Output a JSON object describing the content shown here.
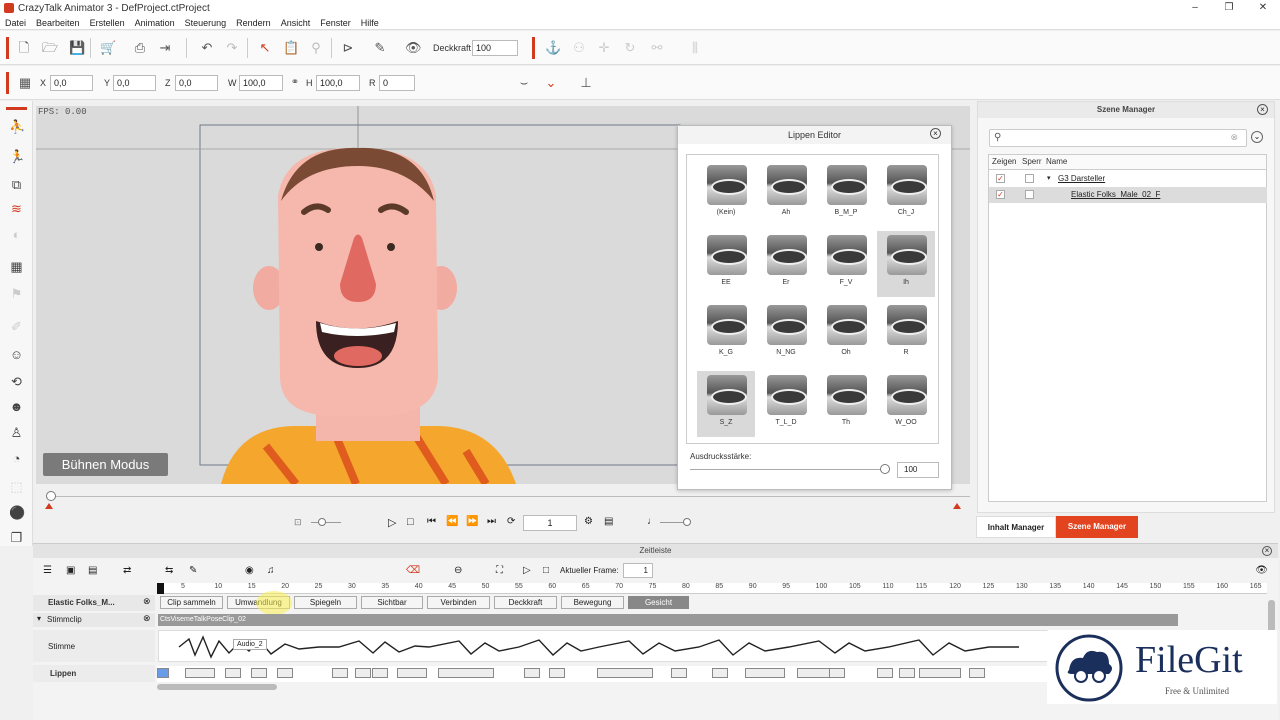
{
  "app": {
    "title": "CrazyTalk Animator 3 - DefProject.ctProject",
    "min": "–",
    "max": "❐",
    "close": "✕"
  },
  "menu": [
    "Datei",
    "Bearbeiten",
    "Erstellen",
    "Animation",
    "Steuerung",
    "Rendern",
    "Ansicht",
    "Fenster",
    "Hilfe"
  ],
  "toolbar1": {
    "opacity_label": "Deckkraft",
    "opacity_value": "100"
  },
  "transform": {
    "x_label": "X",
    "x": "0,0",
    "y_label": "Y",
    "y": "0,0",
    "z_label": "Z",
    "z": "0,0",
    "w_label": "W",
    "w": "100,0",
    "h_label": "H",
    "h": "100,0",
    "r_label": "R",
    "r": "0"
  },
  "stage": {
    "fps": "FPS: 0.00",
    "mode_button": "Bühnen Modus"
  },
  "lip_editor": {
    "title": "Lippen Editor",
    "visemes": [
      "(Kein)",
      "Ah",
      "B_M_P",
      "Ch_J",
      "EE",
      "Er",
      "F_V",
      "Ih",
      "K_G",
      "N_NG",
      "Oh",
      "R",
      "S_Z",
      "T_L_D",
      "Th",
      "W_OO"
    ],
    "strength_label": "Ausdrucksstärke:",
    "strength_value": "100"
  },
  "scene_manager": {
    "title": "Szene Manager",
    "col_show": "Zeigen",
    "col_lock": "Sperr",
    "col_name": "Name",
    "rows": [
      {
        "name": "G3 Darsteller"
      },
      {
        "name": "Elastic Folks_Male_02_F"
      }
    ]
  },
  "tabs": {
    "content": "Inhalt Manager",
    "scene": "Szene Manager",
    "scene_color": "#e2441f"
  },
  "playback": {
    "frame": "1"
  },
  "timeline": {
    "title": "Zeitleiste",
    "current_frame_label": "Aktueller Frame:",
    "current_frame": "1",
    "ticks": [
      "5",
      "10",
      "15",
      "20",
      "25",
      "30",
      "35",
      "40",
      "45",
      "50",
      "55",
      "60",
      "65",
      "70",
      "75",
      "80",
      "85",
      "90",
      "95",
      "100",
      "105",
      "110",
      "115",
      "120",
      "125",
      "130",
      "135",
      "140",
      "145",
      "150",
      "155",
      "160",
      "165"
    ],
    "actor": "Elastic Folks_M...",
    "chips": [
      "Clip sammeln",
      "Umwandlung",
      "Spiegeln",
      "Sichtbar",
      "Verbinden",
      "Deckkraft",
      "Bewegung",
      "Gesicht"
    ],
    "voice_track": "Stimmclip",
    "voice_label": "Stimme",
    "clip_name": "CtsVisemeTalkPoseClip_02",
    "audio_tag": "Audio_2",
    "lips_label": "Lippen"
  },
  "watermark": {
    "brand": "FileGit",
    "tagline": "Free & Unlimited"
  }
}
